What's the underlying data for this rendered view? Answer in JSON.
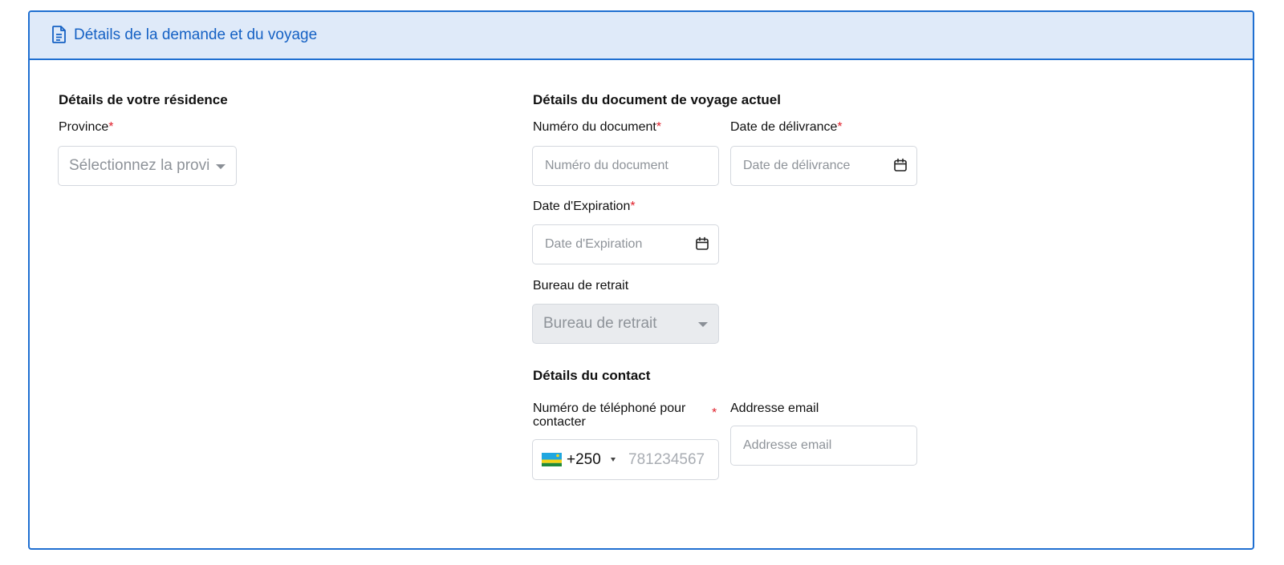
{
  "header": {
    "title": "Détails de la demande et du voyage",
    "icon": "document-icon"
  },
  "residence": {
    "section_title": "Détails de votre résidence",
    "province_label": "Province",
    "province_required": "*",
    "province_placeholder": "Sélectionnez la provi"
  },
  "travel_document": {
    "section_title": "Détails du document de voyage actuel",
    "number_label": "Numéro du document",
    "number_required": "*",
    "number_placeholder": "Numéro du document",
    "issue_date_label": "Date de délivrance",
    "issue_date_required": "*",
    "issue_date_placeholder": "Date de délivrance",
    "expiry_label": "Date d'Expiration",
    "expiry_required": "*",
    "expiry_placeholder": "Date d'Expiration",
    "office_label": "Bureau de retrait",
    "office_placeholder": "Bureau de retrait"
  },
  "contact": {
    "section_title": "Détails du contact",
    "phone_label_line1": "Numéro de téléphoné pour",
    "phone_label_line2": "contacter",
    "phone_required": "*",
    "phone_country_code": "+250",
    "phone_placeholder": "781234567",
    "email_label": "Addresse email",
    "email_placeholder": "Addresse email"
  },
  "colors": {
    "accent": "#1f6fd1",
    "header_bg": "#dfeaf9",
    "required": "#e0202b"
  }
}
